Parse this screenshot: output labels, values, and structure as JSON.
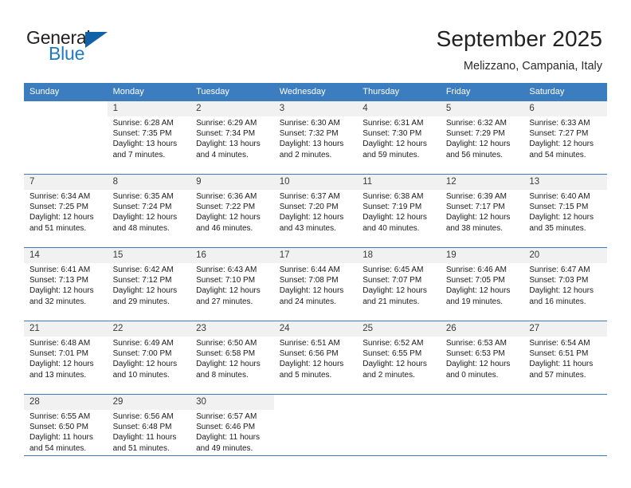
{
  "brand": {
    "name_top": "General",
    "name_bottom": "Blue",
    "logo_icon": "triangle-logo-icon",
    "accent_color": "#1161a9"
  },
  "header": {
    "title": "September 2025",
    "location": "Melizzano, Campania, Italy"
  },
  "theme": {
    "header_bg": "#3c7dc0",
    "daynum_bg": "#f1f1f1",
    "cell_bg": "#ffffff",
    "text": "#1a1a1a"
  },
  "weekdays": [
    "Sunday",
    "Monday",
    "Tuesday",
    "Wednesday",
    "Thursday",
    "Friday",
    "Saturday"
  ],
  "weeks": [
    [
      {
        "day": "",
        "sunrise": "",
        "sunset": "",
        "daylight1": "",
        "daylight2": ""
      },
      {
        "day": "1",
        "sunrise": "Sunrise: 6:28 AM",
        "sunset": "Sunset: 7:35 PM",
        "daylight1": "Daylight: 13 hours",
        "daylight2": "and 7 minutes."
      },
      {
        "day": "2",
        "sunrise": "Sunrise: 6:29 AM",
        "sunset": "Sunset: 7:34 PM",
        "daylight1": "Daylight: 13 hours",
        "daylight2": "and 4 minutes."
      },
      {
        "day": "3",
        "sunrise": "Sunrise: 6:30 AM",
        "sunset": "Sunset: 7:32 PM",
        "daylight1": "Daylight: 13 hours",
        "daylight2": "and 2 minutes."
      },
      {
        "day": "4",
        "sunrise": "Sunrise: 6:31 AM",
        "sunset": "Sunset: 7:30 PM",
        "daylight1": "Daylight: 12 hours",
        "daylight2": "and 59 minutes."
      },
      {
        "day": "5",
        "sunrise": "Sunrise: 6:32 AM",
        "sunset": "Sunset: 7:29 PM",
        "daylight1": "Daylight: 12 hours",
        "daylight2": "and 56 minutes."
      },
      {
        "day": "6",
        "sunrise": "Sunrise: 6:33 AM",
        "sunset": "Sunset: 7:27 PM",
        "daylight1": "Daylight: 12 hours",
        "daylight2": "and 54 minutes."
      }
    ],
    [
      {
        "day": "7",
        "sunrise": "Sunrise: 6:34 AM",
        "sunset": "Sunset: 7:25 PM",
        "daylight1": "Daylight: 12 hours",
        "daylight2": "and 51 minutes."
      },
      {
        "day": "8",
        "sunrise": "Sunrise: 6:35 AM",
        "sunset": "Sunset: 7:24 PM",
        "daylight1": "Daylight: 12 hours",
        "daylight2": "and 48 minutes."
      },
      {
        "day": "9",
        "sunrise": "Sunrise: 6:36 AM",
        "sunset": "Sunset: 7:22 PM",
        "daylight1": "Daylight: 12 hours",
        "daylight2": "and 46 minutes."
      },
      {
        "day": "10",
        "sunrise": "Sunrise: 6:37 AM",
        "sunset": "Sunset: 7:20 PM",
        "daylight1": "Daylight: 12 hours",
        "daylight2": "and 43 minutes."
      },
      {
        "day": "11",
        "sunrise": "Sunrise: 6:38 AM",
        "sunset": "Sunset: 7:19 PM",
        "daylight1": "Daylight: 12 hours",
        "daylight2": "and 40 minutes."
      },
      {
        "day": "12",
        "sunrise": "Sunrise: 6:39 AM",
        "sunset": "Sunset: 7:17 PM",
        "daylight1": "Daylight: 12 hours",
        "daylight2": "and 38 minutes."
      },
      {
        "day": "13",
        "sunrise": "Sunrise: 6:40 AM",
        "sunset": "Sunset: 7:15 PM",
        "daylight1": "Daylight: 12 hours",
        "daylight2": "and 35 minutes."
      }
    ],
    [
      {
        "day": "14",
        "sunrise": "Sunrise: 6:41 AM",
        "sunset": "Sunset: 7:13 PM",
        "daylight1": "Daylight: 12 hours",
        "daylight2": "and 32 minutes."
      },
      {
        "day": "15",
        "sunrise": "Sunrise: 6:42 AM",
        "sunset": "Sunset: 7:12 PM",
        "daylight1": "Daylight: 12 hours",
        "daylight2": "and 29 minutes."
      },
      {
        "day": "16",
        "sunrise": "Sunrise: 6:43 AM",
        "sunset": "Sunset: 7:10 PM",
        "daylight1": "Daylight: 12 hours",
        "daylight2": "and 27 minutes."
      },
      {
        "day": "17",
        "sunrise": "Sunrise: 6:44 AM",
        "sunset": "Sunset: 7:08 PM",
        "daylight1": "Daylight: 12 hours",
        "daylight2": "and 24 minutes."
      },
      {
        "day": "18",
        "sunrise": "Sunrise: 6:45 AM",
        "sunset": "Sunset: 7:07 PM",
        "daylight1": "Daylight: 12 hours",
        "daylight2": "and 21 minutes."
      },
      {
        "day": "19",
        "sunrise": "Sunrise: 6:46 AM",
        "sunset": "Sunset: 7:05 PM",
        "daylight1": "Daylight: 12 hours",
        "daylight2": "and 19 minutes."
      },
      {
        "day": "20",
        "sunrise": "Sunrise: 6:47 AM",
        "sunset": "Sunset: 7:03 PM",
        "daylight1": "Daylight: 12 hours",
        "daylight2": "and 16 minutes."
      }
    ],
    [
      {
        "day": "21",
        "sunrise": "Sunrise: 6:48 AM",
        "sunset": "Sunset: 7:01 PM",
        "daylight1": "Daylight: 12 hours",
        "daylight2": "and 13 minutes."
      },
      {
        "day": "22",
        "sunrise": "Sunrise: 6:49 AM",
        "sunset": "Sunset: 7:00 PM",
        "daylight1": "Daylight: 12 hours",
        "daylight2": "and 10 minutes."
      },
      {
        "day": "23",
        "sunrise": "Sunrise: 6:50 AM",
        "sunset": "Sunset: 6:58 PM",
        "daylight1": "Daylight: 12 hours",
        "daylight2": "and 8 minutes."
      },
      {
        "day": "24",
        "sunrise": "Sunrise: 6:51 AM",
        "sunset": "Sunset: 6:56 PM",
        "daylight1": "Daylight: 12 hours",
        "daylight2": "and 5 minutes."
      },
      {
        "day": "25",
        "sunrise": "Sunrise: 6:52 AM",
        "sunset": "Sunset: 6:55 PM",
        "daylight1": "Daylight: 12 hours",
        "daylight2": "and 2 minutes."
      },
      {
        "day": "26",
        "sunrise": "Sunrise: 6:53 AM",
        "sunset": "Sunset: 6:53 PM",
        "daylight1": "Daylight: 12 hours",
        "daylight2": "and 0 minutes."
      },
      {
        "day": "27",
        "sunrise": "Sunrise: 6:54 AM",
        "sunset": "Sunset: 6:51 PM",
        "daylight1": "Daylight: 11 hours",
        "daylight2": "and 57 minutes."
      }
    ],
    [
      {
        "day": "28",
        "sunrise": "Sunrise: 6:55 AM",
        "sunset": "Sunset: 6:50 PM",
        "daylight1": "Daylight: 11 hours",
        "daylight2": "and 54 minutes."
      },
      {
        "day": "29",
        "sunrise": "Sunrise: 6:56 AM",
        "sunset": "Sunset: 6:48 PM",
        "daylight1": "Daylight: 11 hours",
        "daylight2": "and 51 minutes."
      },
      {
        "day": "30",
        "sunrise": "Sunrise: 6:57 AM",
        "sunset": "Sunset: 6:46 PM",
        "daylight1": "Daylight: 11 hours",
        "daylight2": "and 49 minutes."
      },
      {
        "day": "",
        "sunrise": "",
        "sunset": "",
        "daylight1": "",
        "daylight2": ""
      },
      {
        "day": "",
        "sunrise": "",
        "sunset": "",
        "daylight1": "",
        "daylight2": ""
      },
      {
        "day": "",
        "sunrise": "",
        "sunset": "",
        "daylight1": "",
        "daylight2": ""
      },
      {
        "day": "",
        "sunrise": "",
        "sunset": "",
        "daylight1": "",
        "daylight2": ""
      }
    ]
  ]
}
